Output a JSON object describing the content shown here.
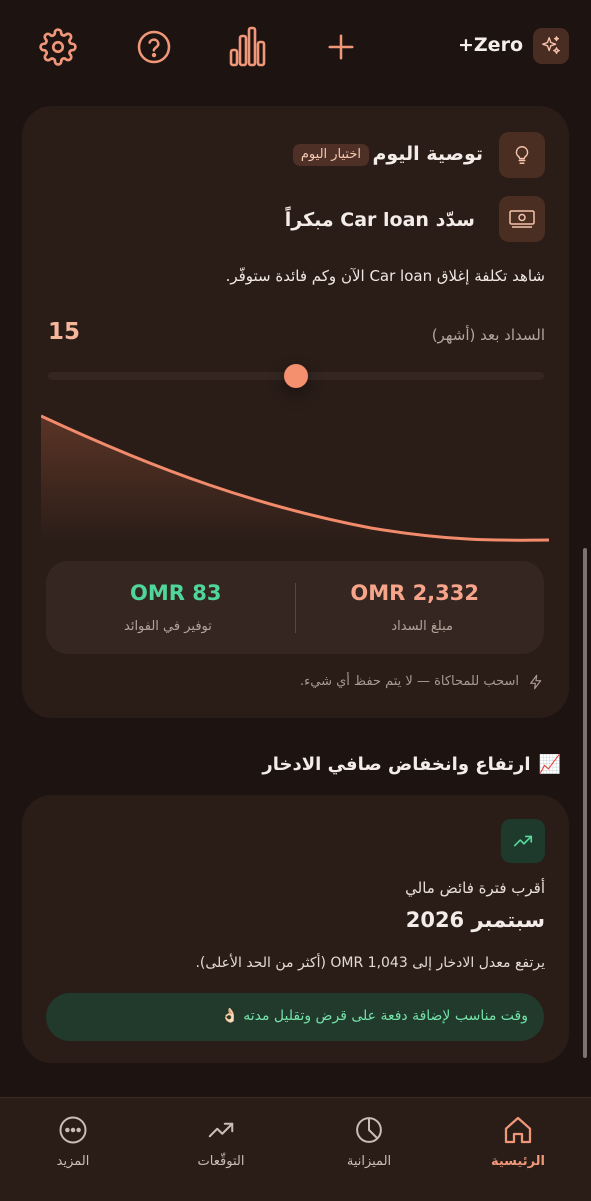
{
  "topbar": {
    "brand_label": "+Zero",
    "icons": [
      "settings-icon",
      "help-icon",
      "stats-icon",
      "add-icon",
      "sparkle-icon"
    ]
  },
  "recommendation": {
    "title": "توصية اليوم",
    "chip": "اختيار اليوم",
    "headline": "سدّد Car loan مبكراً",
    "description": "شاهد تكلفة إغلاق Car loan الآن وكم فائدة ستوفّر.",
    "slider_label": "السداد بعد (أشهر)",
    "slider_value": "15",
    "slider_position": 0.5,
    "stats": {
      "payoff_value": "OMR 2,332",
      "payoff_label": "مبلغ السداد",
      "savings_value": "OMR 83",
      "savings_label": "توفير في الفوائد"
    },
    "hint": "اسحب للمحاكاة — لا يتم حفظ أي شيء."
  },
  "savings_section": {
    "heading": "ارتفاع وانخفاض صافي الادخار",
    "heading_emoji": "📈",
    "card_label": "أقرب فترة فائض مالي",
    "card_date": "سبتمبر 2026",
    "card_text": "يرتفع معدل الادخار إلى OMR 1,043 (أكثر من الحد الأعلى).",
    "tip": "وقت مناسب لإضافة دفعة على قرض وتقليل مدته 👌🏻"
  },
  "nav": {
    "home": "الرئيسية",
    "budget": "الميزانية",
    "forecasts": "التوقّعات",
    "more": "المزيد"
  },
  "colors": {
    "accent": "#f28b6b",
    "positive": "#4fd79b",
    "background": "#1d1411",
    "card": "#2a1d18"
  }
}
